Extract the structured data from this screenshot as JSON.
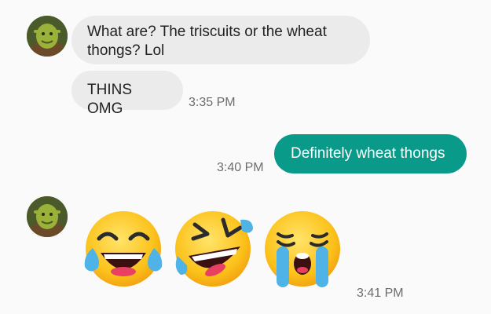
{
  "conversation": {
    "messages": [
      {
        "direction": "incoming",
        "text": "What are? The triscuits or the wheat thongs? Lol",
        "avatar_icon": "shrek-avatar"
      },
      {
        "direction": "incoming",
        "text": "THINS OMG",
        "timestamp": "3:35 PM"
      },
      {
        "direction": "outgoing",
        "text": "Definitely wheat thongs",
        "timestamp": "3:40 PM"
      },
      {
        "direction": "incoming",
        "emojis": [
          "tears-of-joy-emoji",
          "rolling-laughing-emoji",
          "loudly-crying-emoji"
        ],
        "timestamp": "3:41 PM",
        "avatar_icon": "shrek-avatar"
      }
    ]
  },
  "colors": {
    "background": "#fafafa",
    "incoming_bubble": "#ebebeb",
    "outgoing_bubble": "#0a9a8a",
    "timestamp": "#6d6d6d"
  }
}
